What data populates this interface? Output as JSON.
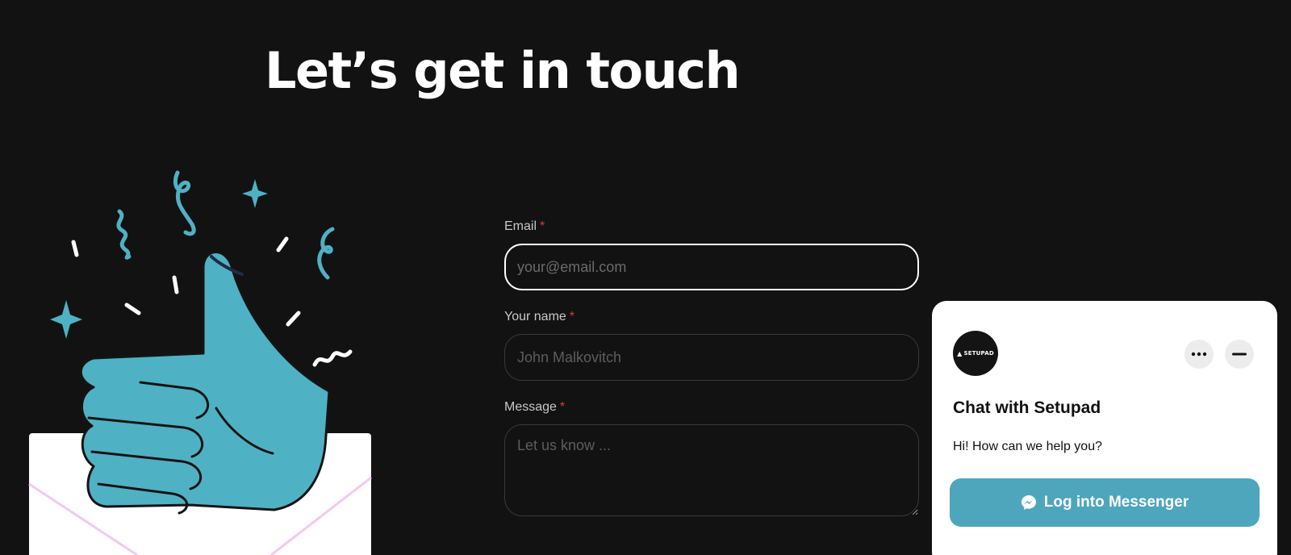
{
  "header": {
    "title": "Let’s get in touch"
  },
  "form": {
    "email": {
      "label": "Email",
      "required_marker": "*",
      "placeholder": "your@email.com"
    },
    "name": {
      "label": "Your name",
      "required_marker": "*",
      "placeholder": "John Malkovitch"
    },
    "message": {
      "label": "Message",
      "required_marker": "*",
      "placeholder": "Let us know ..."
    }
  },
  "chat": {
    "logo_text": "SETUPAD",
    "more_icon": "more-dots-icon",
    "minimize_icon": "minimize-icon",
    "title": "Chat with Setupad",
    "greeting": "Hi! How can we help you?",
    "messenger_button": "Log into Messenger",
    "messenger_icon": "messenger-icon"
  },
  "illustration": {
    "subject": "thumbs-up-hand-with-confetti",
    "accent_color": "#4fb1c4"
  },
  "colors": {
    "background": "#121212",
    "accent": "#4ea6bc",
    "required": "#e03a3a",
    "panel": "#ffffff"
  }
}
